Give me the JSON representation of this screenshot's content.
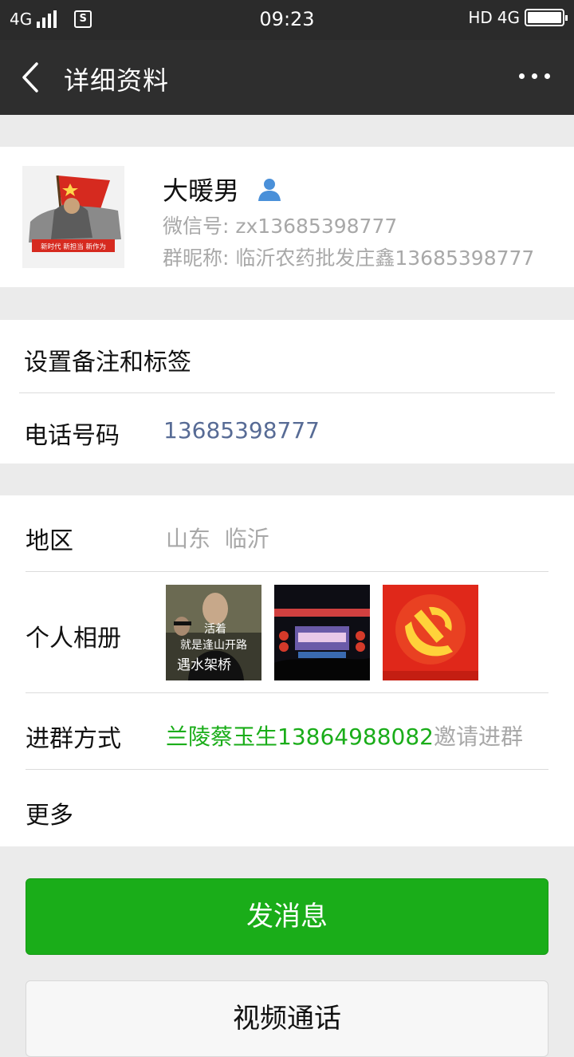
{
  "status_bar": {
    "network": "4G",
    "time": "09:23",
    "hd_label": "HD",
    "network_right": "4G",
    "sim_icon": "S",
    "battery_level": 1.0
  },
  "header": {
    "title": "详细资料",
    "back_icon": "chevron-left",
    "more_icon": "ellipsis-horizontal"
  },
  "profile": {
    "name": "大暖男",
    "wechat_id": "微信号: zx13685398777",
    "group_nickname": "群昵称: 临沂农药批发庄鑫13685398777",
    "avatar_caption": "新时代 新担当 新作为"
  },
  "section_remark": {
    "set_remark_label": "设置备注和标签",
    "phone_label": "电话号码",
    "phone_value": "13685398777"
  },
  "section_info": {
    "region_label": "地区",
    "region_value": "山东  临沂",
    "album_label": "个人相册",
    "album_thumb1_text_line1": "活着",
    "album_thumb1_text_line2": "就是逢山开路",
    "album_thumb1_text_line3": "遇水架桥",
    "join_label": "进群方式",
    "join_inviter": "兰陵蔡玉生13864988082",
    "join_suffix": "邀请进群",
    "more_label": "更多"
  },
  "buttons": {
    "send_message": "发消息",
    "video_call": "视频通话"
  },
  "colors": {
    "nav_bg": "#2e2e2e",
    "accent_green": "#1aad19",
    "link_blue": "#576b95",
    "inviter_green": "#1aad19",
    "secondary_text": "#a8a8a8"
  }
}
